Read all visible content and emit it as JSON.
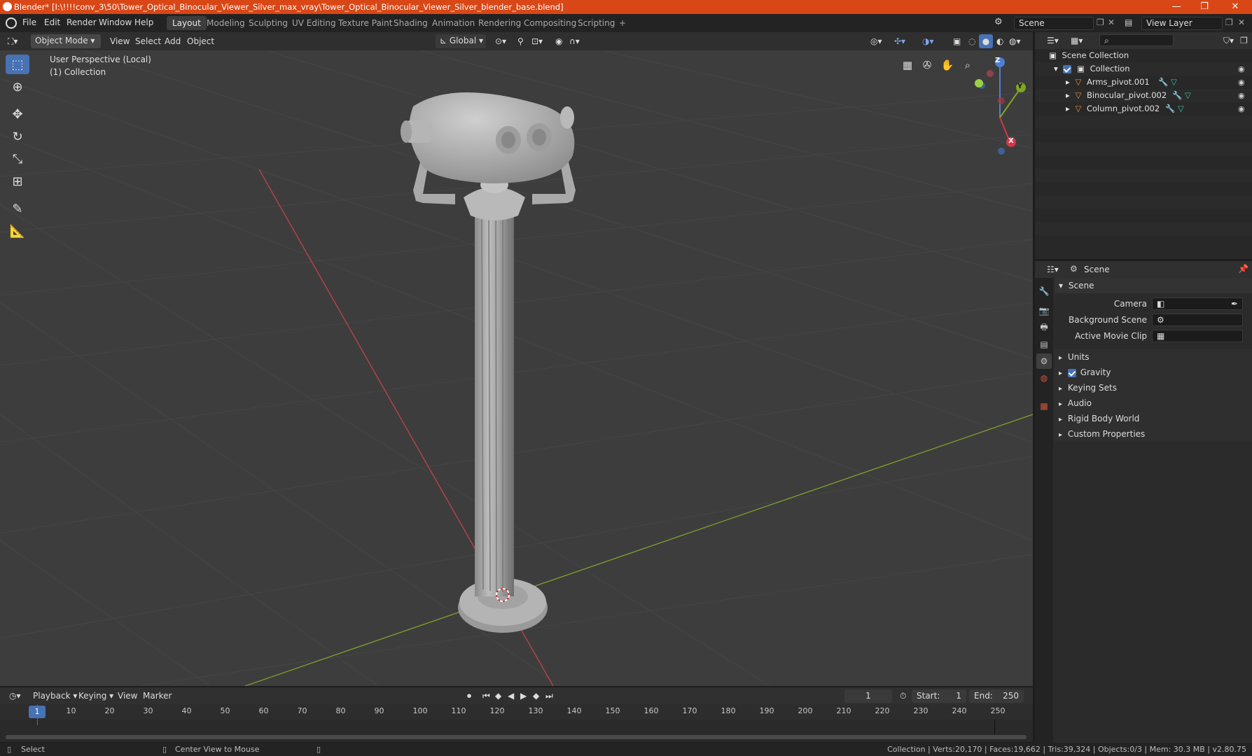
{
  "window": {
    "title": "Blender* [I:\\!!!!conv_3\\50\\Tower_Optical_Binocular_Viewer_Silver_max_vray\\Tower_Optical_Binocular_Viewer_Silver_blender_base.blend]",
    "minimize": "—",
    "maximize": "❐",
    "close": "✕"
  },
  "menu": {
    "items": [
      "File",
      "Edit",
      "Render",
      "Window",
      "Help"
    ],
    "workspaces": [
      "Layout",
      "Modeling",
      "Sculpting",
      "UV Editing",
      "Texture Paint",
      "Shading",
      "Animation",
      "Rendering",
      "Compositing",
      "Scripting"
    ],
    "active_workspace": "Layout",
    "add_workspace": "+",
    "scene_value": "Scene",
    "view_layer_value": "View Layer"
  },
  "viewport_header": {
    "mode": "Object Mode",
    "menus": [
      "View",
      "Select",
      "Add",
      "Object"
    ],
    "orientation": "Global"
  },
  "viewport": {
    "perspective_label": "User Perspective (Local)",
    "collection_label": "(1) Collection",
    "gizmo": {
      "x": "X",
      "y": "Y",
      "z": "Z"
    },
    "colors": {
      "x_axis": "#b8434a",
      "y_axis": "#7c9a2c",
      "background": "#3d3d3d",
      "grid": "#484848"
    }
  },
  "outliner": {
    "root": "Scene Collection",
    "collection": "Collection",
    "objects": [
      "Arms_pivot.001",
      "Binocular_pivot.002",
      "Column_pivot.002"
    ]
  },
  "properties": {
    "header_label": "Scene",
    "panel_title": "Scene",
    "fields": [
      {
        "label": "Camera",
        "value": ""
      },
      {
        "label": "Background Scene",
        "value": ""
      },
      {
        "label": "Active Movie Clip",
        "value": ""
      }
    ],
    "sections": [
      "Units",
      "Gravity",
      "Keying Sets",
      "Audio",
      "Rigid Body World",
      "Custom Properties"
    ],
    "gravity_checked": true
  },
  "timeline": {
    "menus": [
      "Playback",
      "Keying",
      "View",
      "Marker"
    ],
    "current_frame": "1",
    "start_label": "Start:",
    "start_value": "1",
    "end_label": "End:",
    "end_value": "250",
    "ticks": [
      "1",
      "10",
      "20",
      "30",
      "40",
      "50",
      "60",
      "70",
      "80",
      "90",
      "100",
      "110",
      "120",
      "130",
      "140",
      "150",
      "160",
      "170",
      "180",
      "190",
      "200",
      "210",
      "220",
      "230",
      "240",
      "250"
    ]
  },
  "statusbar": {
    "left": "Select",
    "middle": "Center View to Mouse",
    "right": "Collection | Verts:20,170 | Faces:19,662 | Tris:39,324 | Objects:0/3 | Mem: 30.3 MB | v2.80.75"
  }
}
